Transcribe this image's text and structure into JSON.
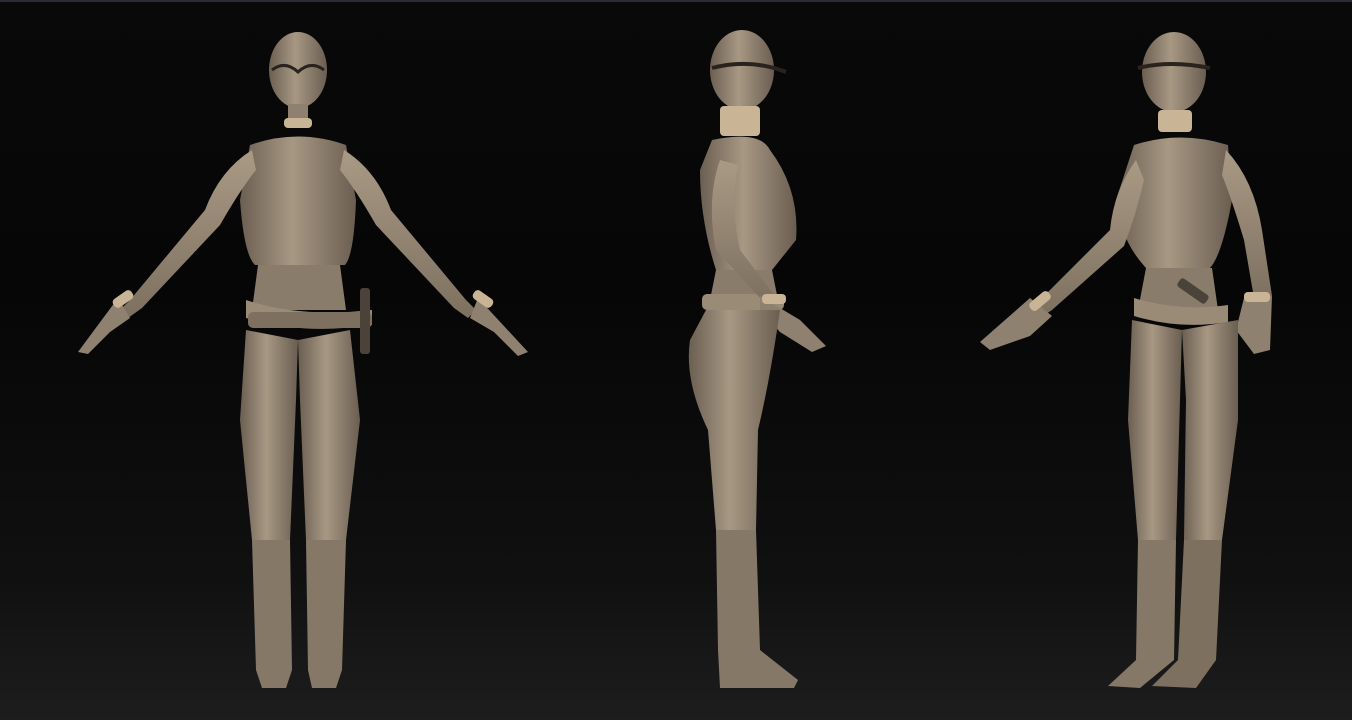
{
  "viewport": {
    "background_top": "#080808",
    "background_bottom": "#1d1d1d",
    "border_color": "#2b2b3a"
  },
  "material": {
    "base": "#8f8170",
    "light": "#b3a48f",
    "shadow": "#5e5347",
    "accent": "#c9b596"
  },
  "views": [
    {
      "id": "front",
      "label": ""
    },
    {
      "id": "side",
      "label": ""
    },
    {
      "id": "three-quarter",
      "label": ""
    }
  ]
}
